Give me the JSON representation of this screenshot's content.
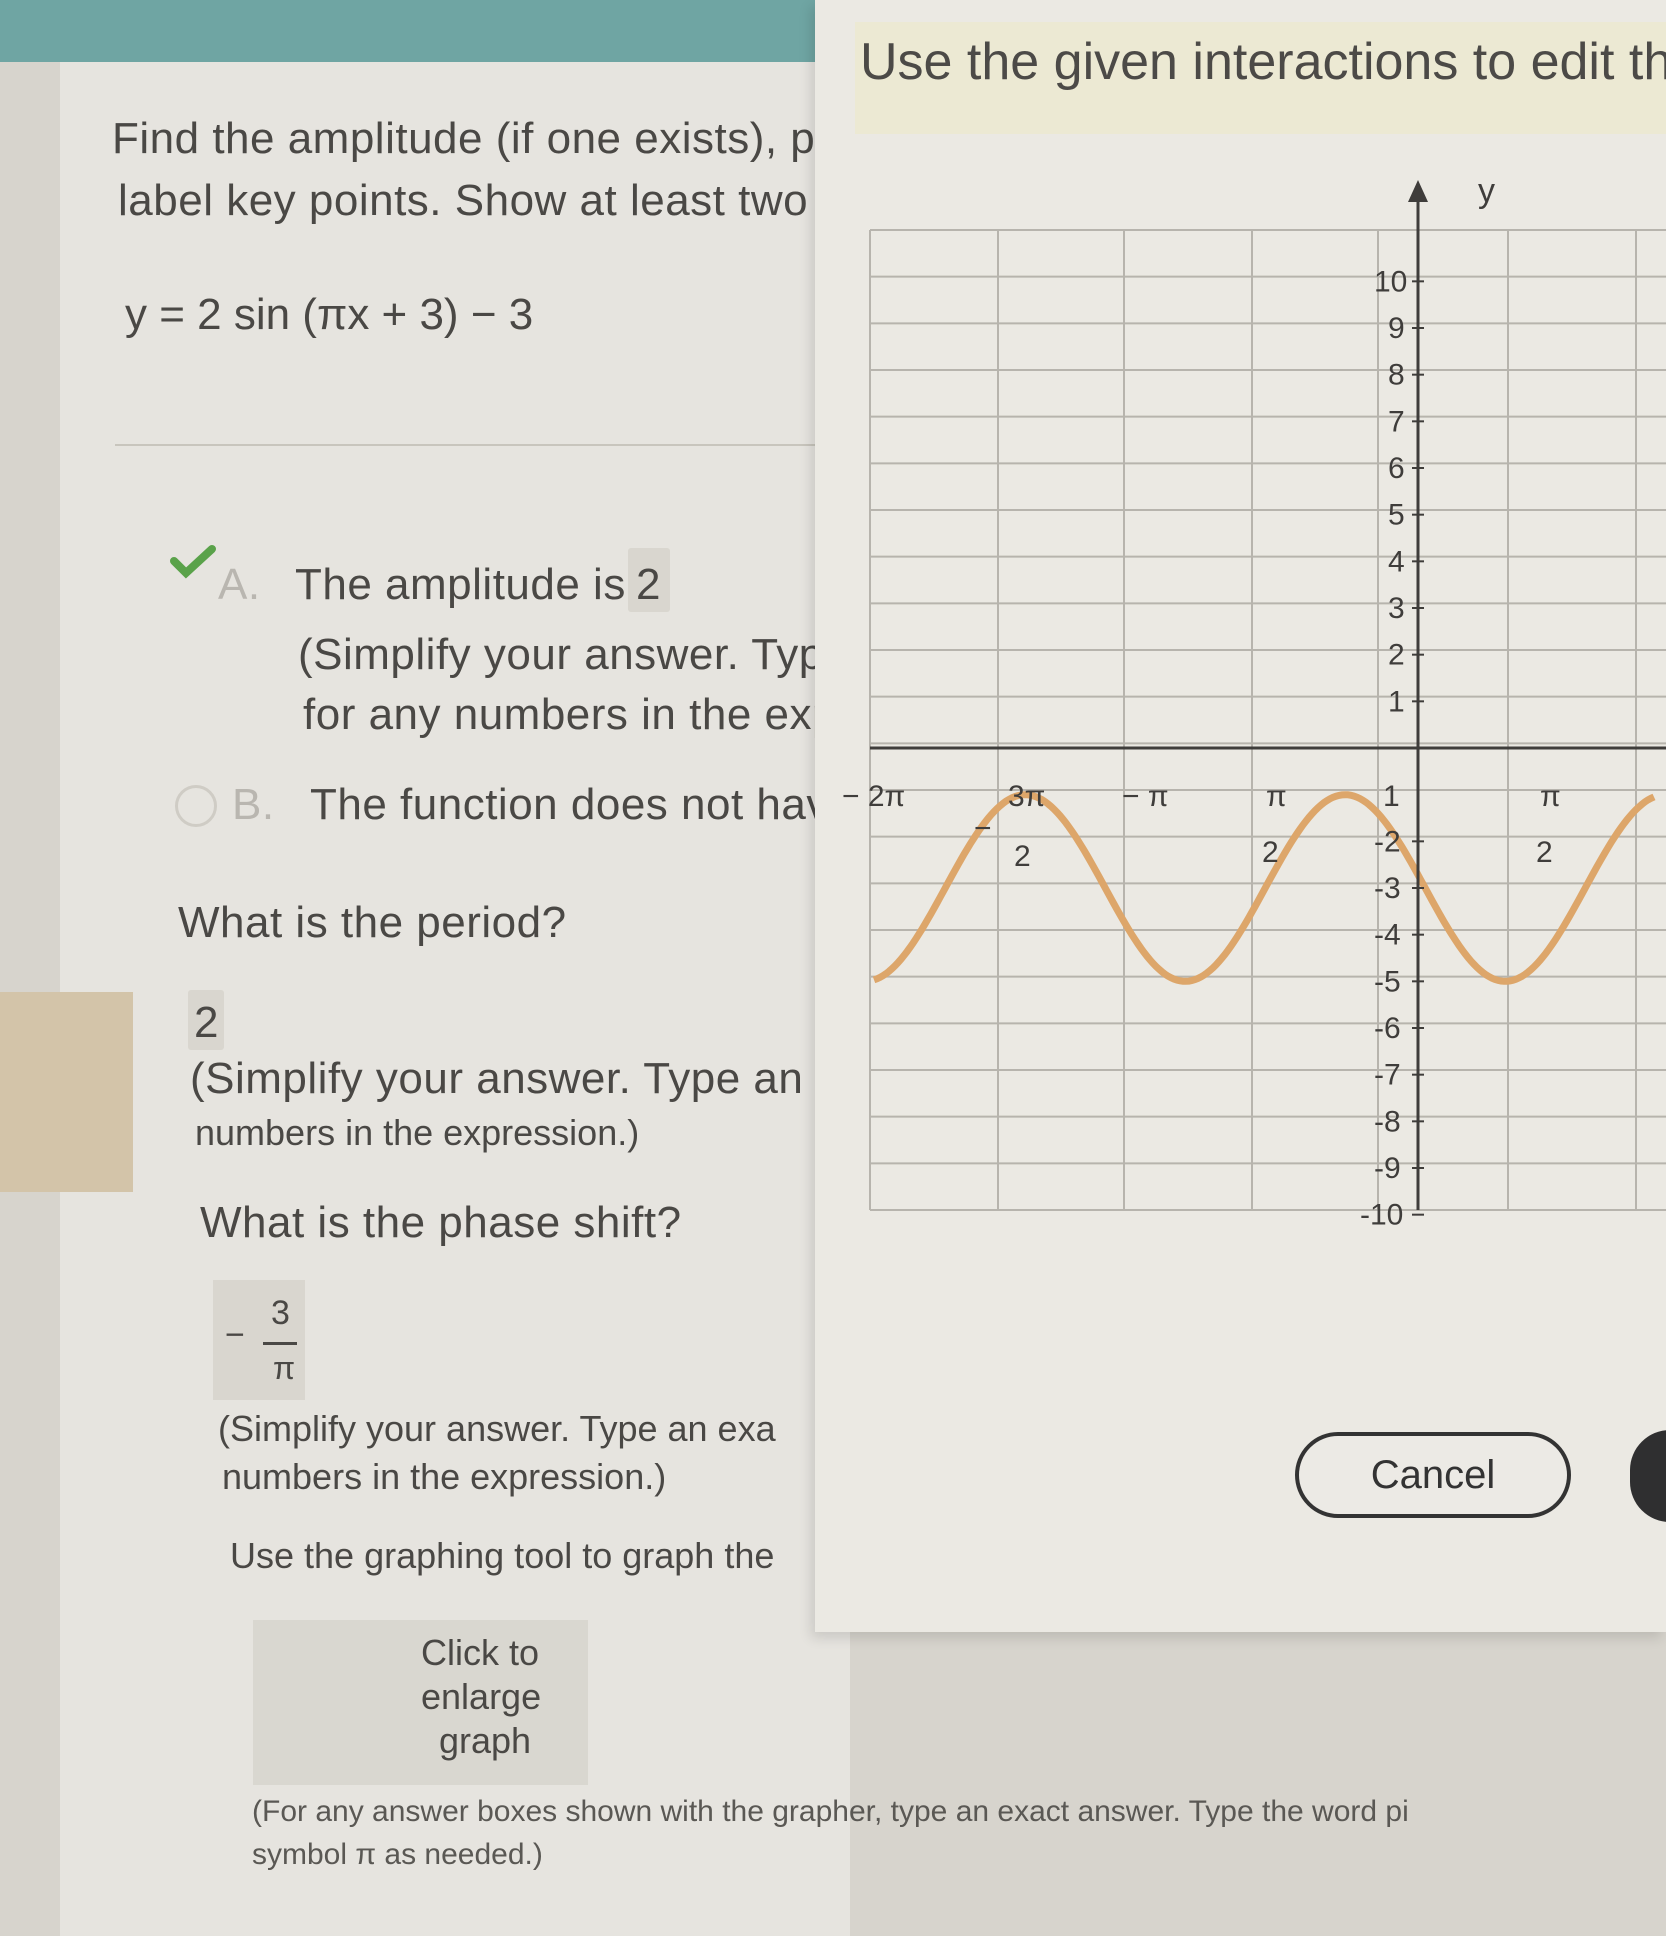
{
  "question": {
    "prompt_line1": "Find the amplitude (if one exists), p",
    "prompt_line2": "label key points. Show at least two",
    "equation": "y = 2 sin (πx + 3) − 3"
  },
  "amplitude": {
    "option_a_letter": "A.",
    "option_a_text": "The amplitude is",
    "option_a_value": "2",
    "hint_line1": "(Simplify your answer. Type",
    "hint_line2": "for any numbers in the expr",
    "option_b_letter": "B.",
    "option_b_text": "The function does not have"
  },
  "period": {
    "question": "What is the period?",
    "value": "2",
    "hint_line1": "(Simplify your answer. Type an exa",
    "hint_line2": "numbers in the expression.)"
  },
  "phase_shift": {
    "question": "What is the phase shift?",
    "sign": "−",
    "numerator": "3",
    "denominator": "π",
    "hint_line1": "(Simplify your answer. Type an exa",
    "hint_line2": "numbers in the expression.)"
  },
  "graph_prompt": "Use the graphing tool to graph the",
  "thumbnail": {
    "line1": "Click to",
    "line2": "enlarge",
    "line3": "graph"
  },
  "footer": {
    "line1": "(For any answer boxes shown with the grapher, type an exact answer. Type the word pi",
    "line2": "symbol π as needed.)"
  },
  "modal": {
    "banner": "Use the given interactions to edit the",
    "cancel_label": "Cancel"
  },
  "graph": {
    "y_axis_label": "y",
    "y_ticks_positive": [
      "10",
      "9",
      "8",
      "7",
      "6",
      "5",
      "4",
      "3",
      "2",
      "1"
    ],
    "y_ticks_negative": [
      "-2",
      "-3",
      "-4",
      "-5",
      "-6",
      "-7",
      "-8",
      "-9",
      "-10"
    ],
    "x_label_neg_2pi": "− 2π",
    "x_label_3pi_num": "3π",
    "x_label_3pi_minus": "−",
    "x_label_3pi_den": "2",
    "x_label_neg_pi": "− π",
    "x_label_pi2_num": "π",
    "x_label_pi2_den": "2",
    "x_label_1": "1",
    "x_label_pi2b_num": "π",
    "x_label_pi2b_den": "2",
    "curve_color": "#dda66a",
    "grid_color": "#b7b4ad",
    "axis_color": "#3f3d3b"
  }
}
